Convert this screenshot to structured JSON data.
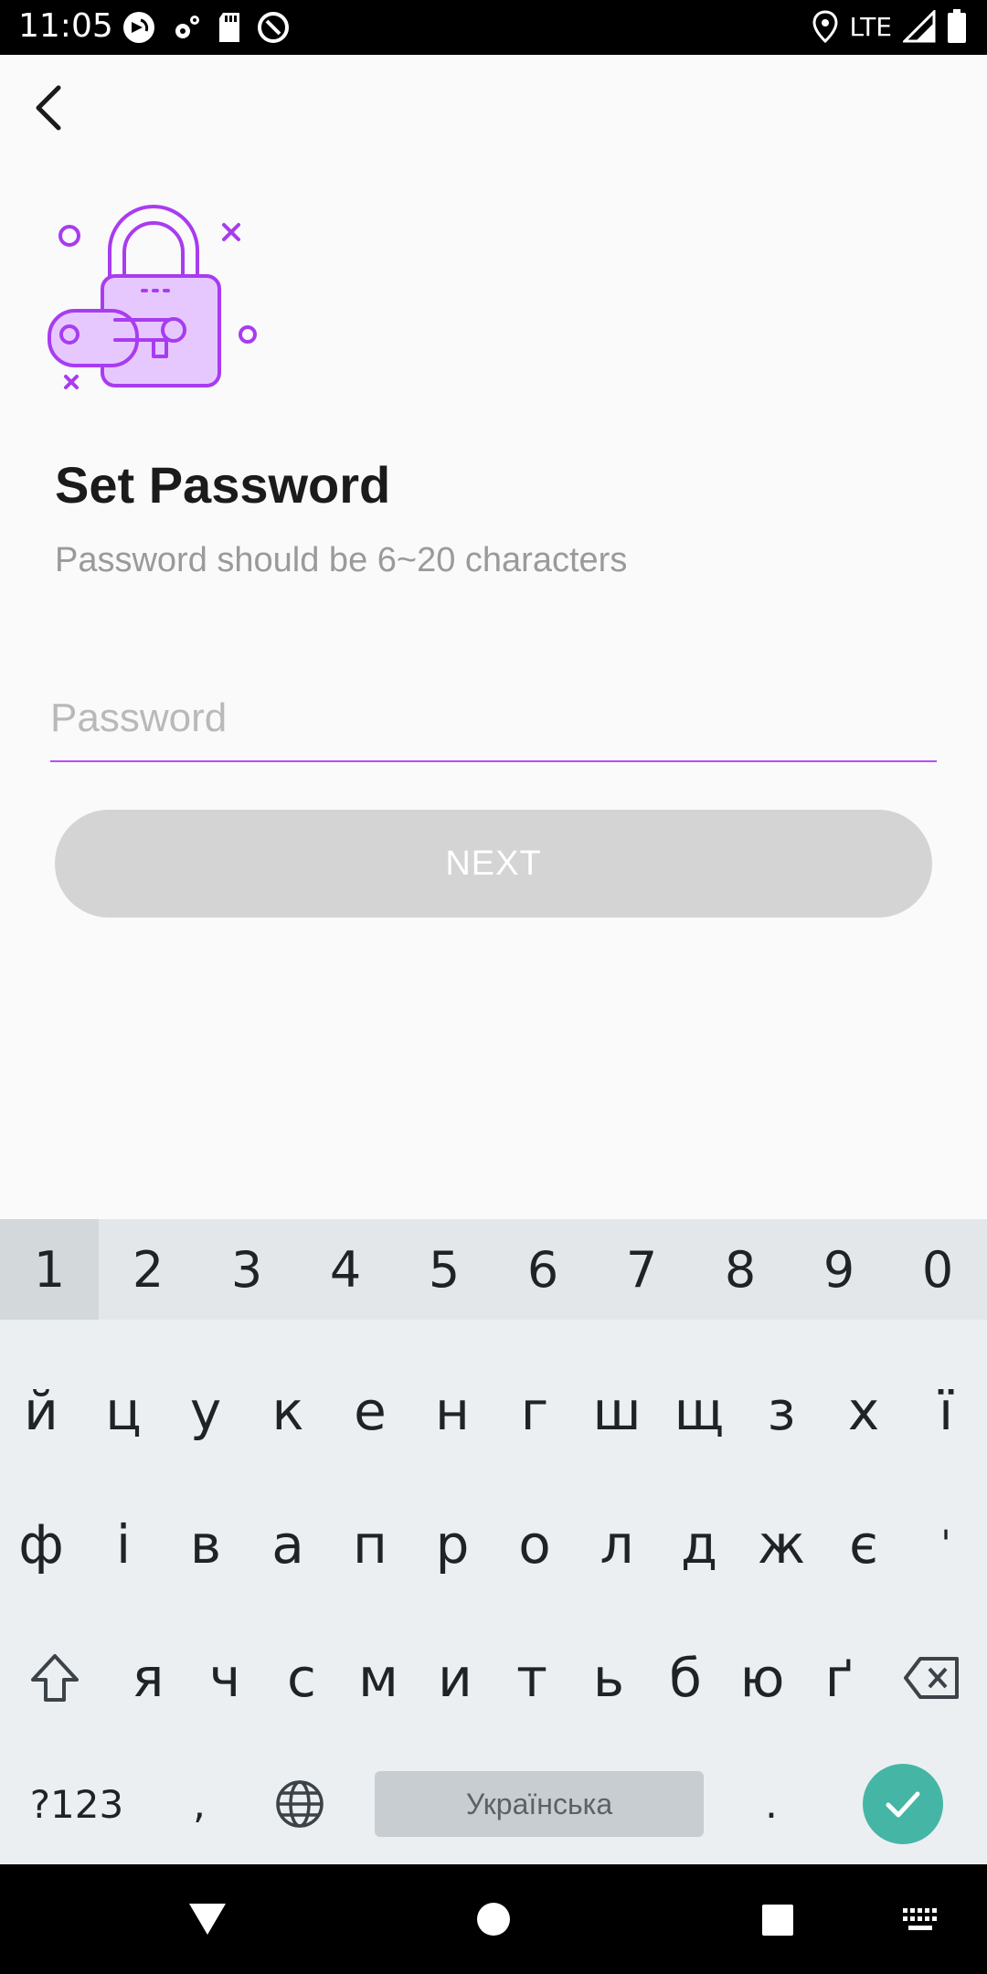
{
  "status_bar": {
    "time": "11:05",
    "network": "LTE"
  },
  "screen": {
    "title": "Set Password",
    "subtitle": "Password should be 6~20 characters",
    "password_placeholder": "Password",
    "password_value": "",
    "next_label": "NEXT"
  },
  "colors": {
    "accent": "#b84bff",
    "illustration_fill": "#e6c8ff",
    "button_disabled": "#d4d4d4",
    "enter_key": "#45b6a6"
  },
  "keyboard": {
    "numbers": [
      "1",
      "2",
      "3",
      "4",
      "5",
      "6",
      "7",
      "8",
      "9",
      "0"
    ],
    "row1": [
      "й",
      "ц",
      "у",
      "к",
      "е",
      "н",
      "г",
      "ш",
      "щ",
      "з",
      "х",
      "ї"
    ],
    "row2": [
      "ф",
      "і",
      "в",
      "а",
      "п",
      "р",
      "о",
      "л",
      "д",
      "ж",
      "є",
      "'"
    ],
    "row3": [
      "я",
      "ч",
      "с",
      "м",
      "и",
      "т",
      "ь",
      "б",
      "ю",
      "ґ"
    ],
    "symbols_label": "?123",
    "comma": ",",
    "space_label": "Українська",
    "period": "."
  }
}
